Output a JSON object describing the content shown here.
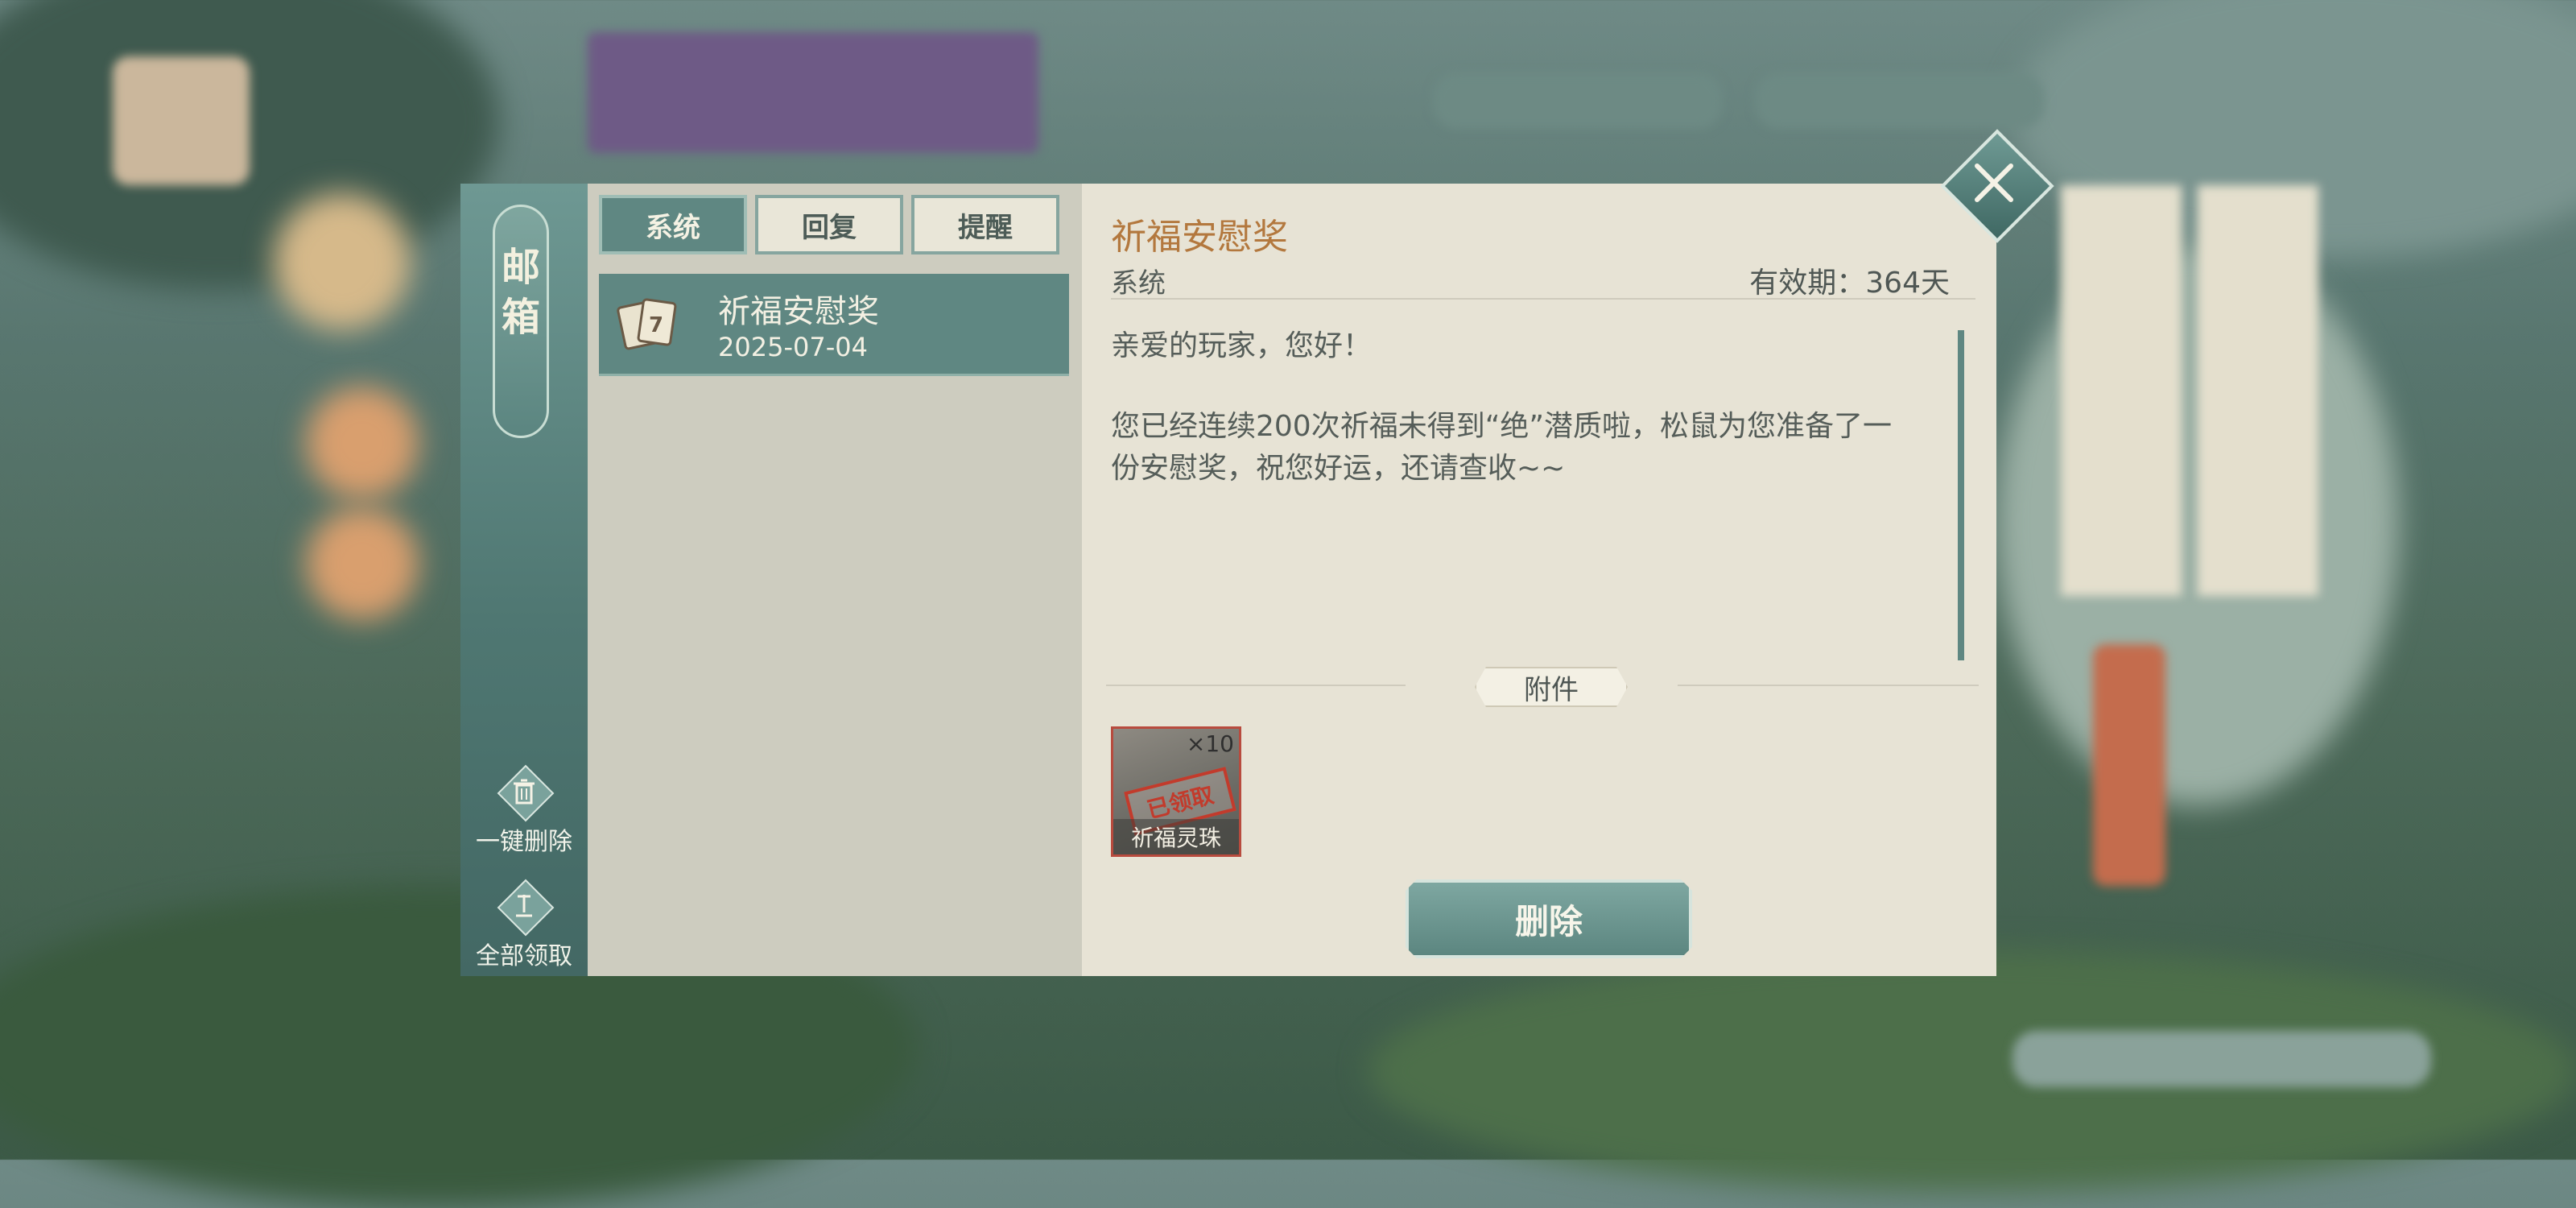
{
  "sidebar": {
    "title_chars": [
      "邮",
      "箱"
    ],
    "delete_all_label": "一键删除",
    "claim_all_label": "全部领取"
  },
  "tabs": [
    {
      "label": "系统",
      "active": true
    },
    {
      "label": "回复",
      "active": false
    },
    {
      "label": "提醒",
      "active": false
    }
  ],
  "mail_list": [
    {
      "title": "祈福安慰奖",
      "date": "2025-07-04"
    }
  ],
  "detail": {
    "title": "祈福安慰奖",
    "sender": "系统",
    "expiry": "有效期：364天",
    "greeting": "亲爱的玩家，您好！",
    "body": "您已经连续200次祈福未得到“绝”潜质啦，松鼠为您准备了一份安慰奖，祝您好运，还请查收~~",
    "attachment_label": "附件",
    "attachment": {
      "name": "祈福灵珠",
      "count": "×10",
      "stamp": "已领取"
    },
    "delete_button": "删除"
  },
  "colors": {
    "accent_teal": "#5f8782",
    "title_orange": "#b3783e",
    "stamp_red": "#c23b2c"
  },
  "icons": {
    "close": "close-icon",
    "trash": "trash-icon",
    "claim": "claim-icon",
    "mail": "mail-card-icon"
  }
}
